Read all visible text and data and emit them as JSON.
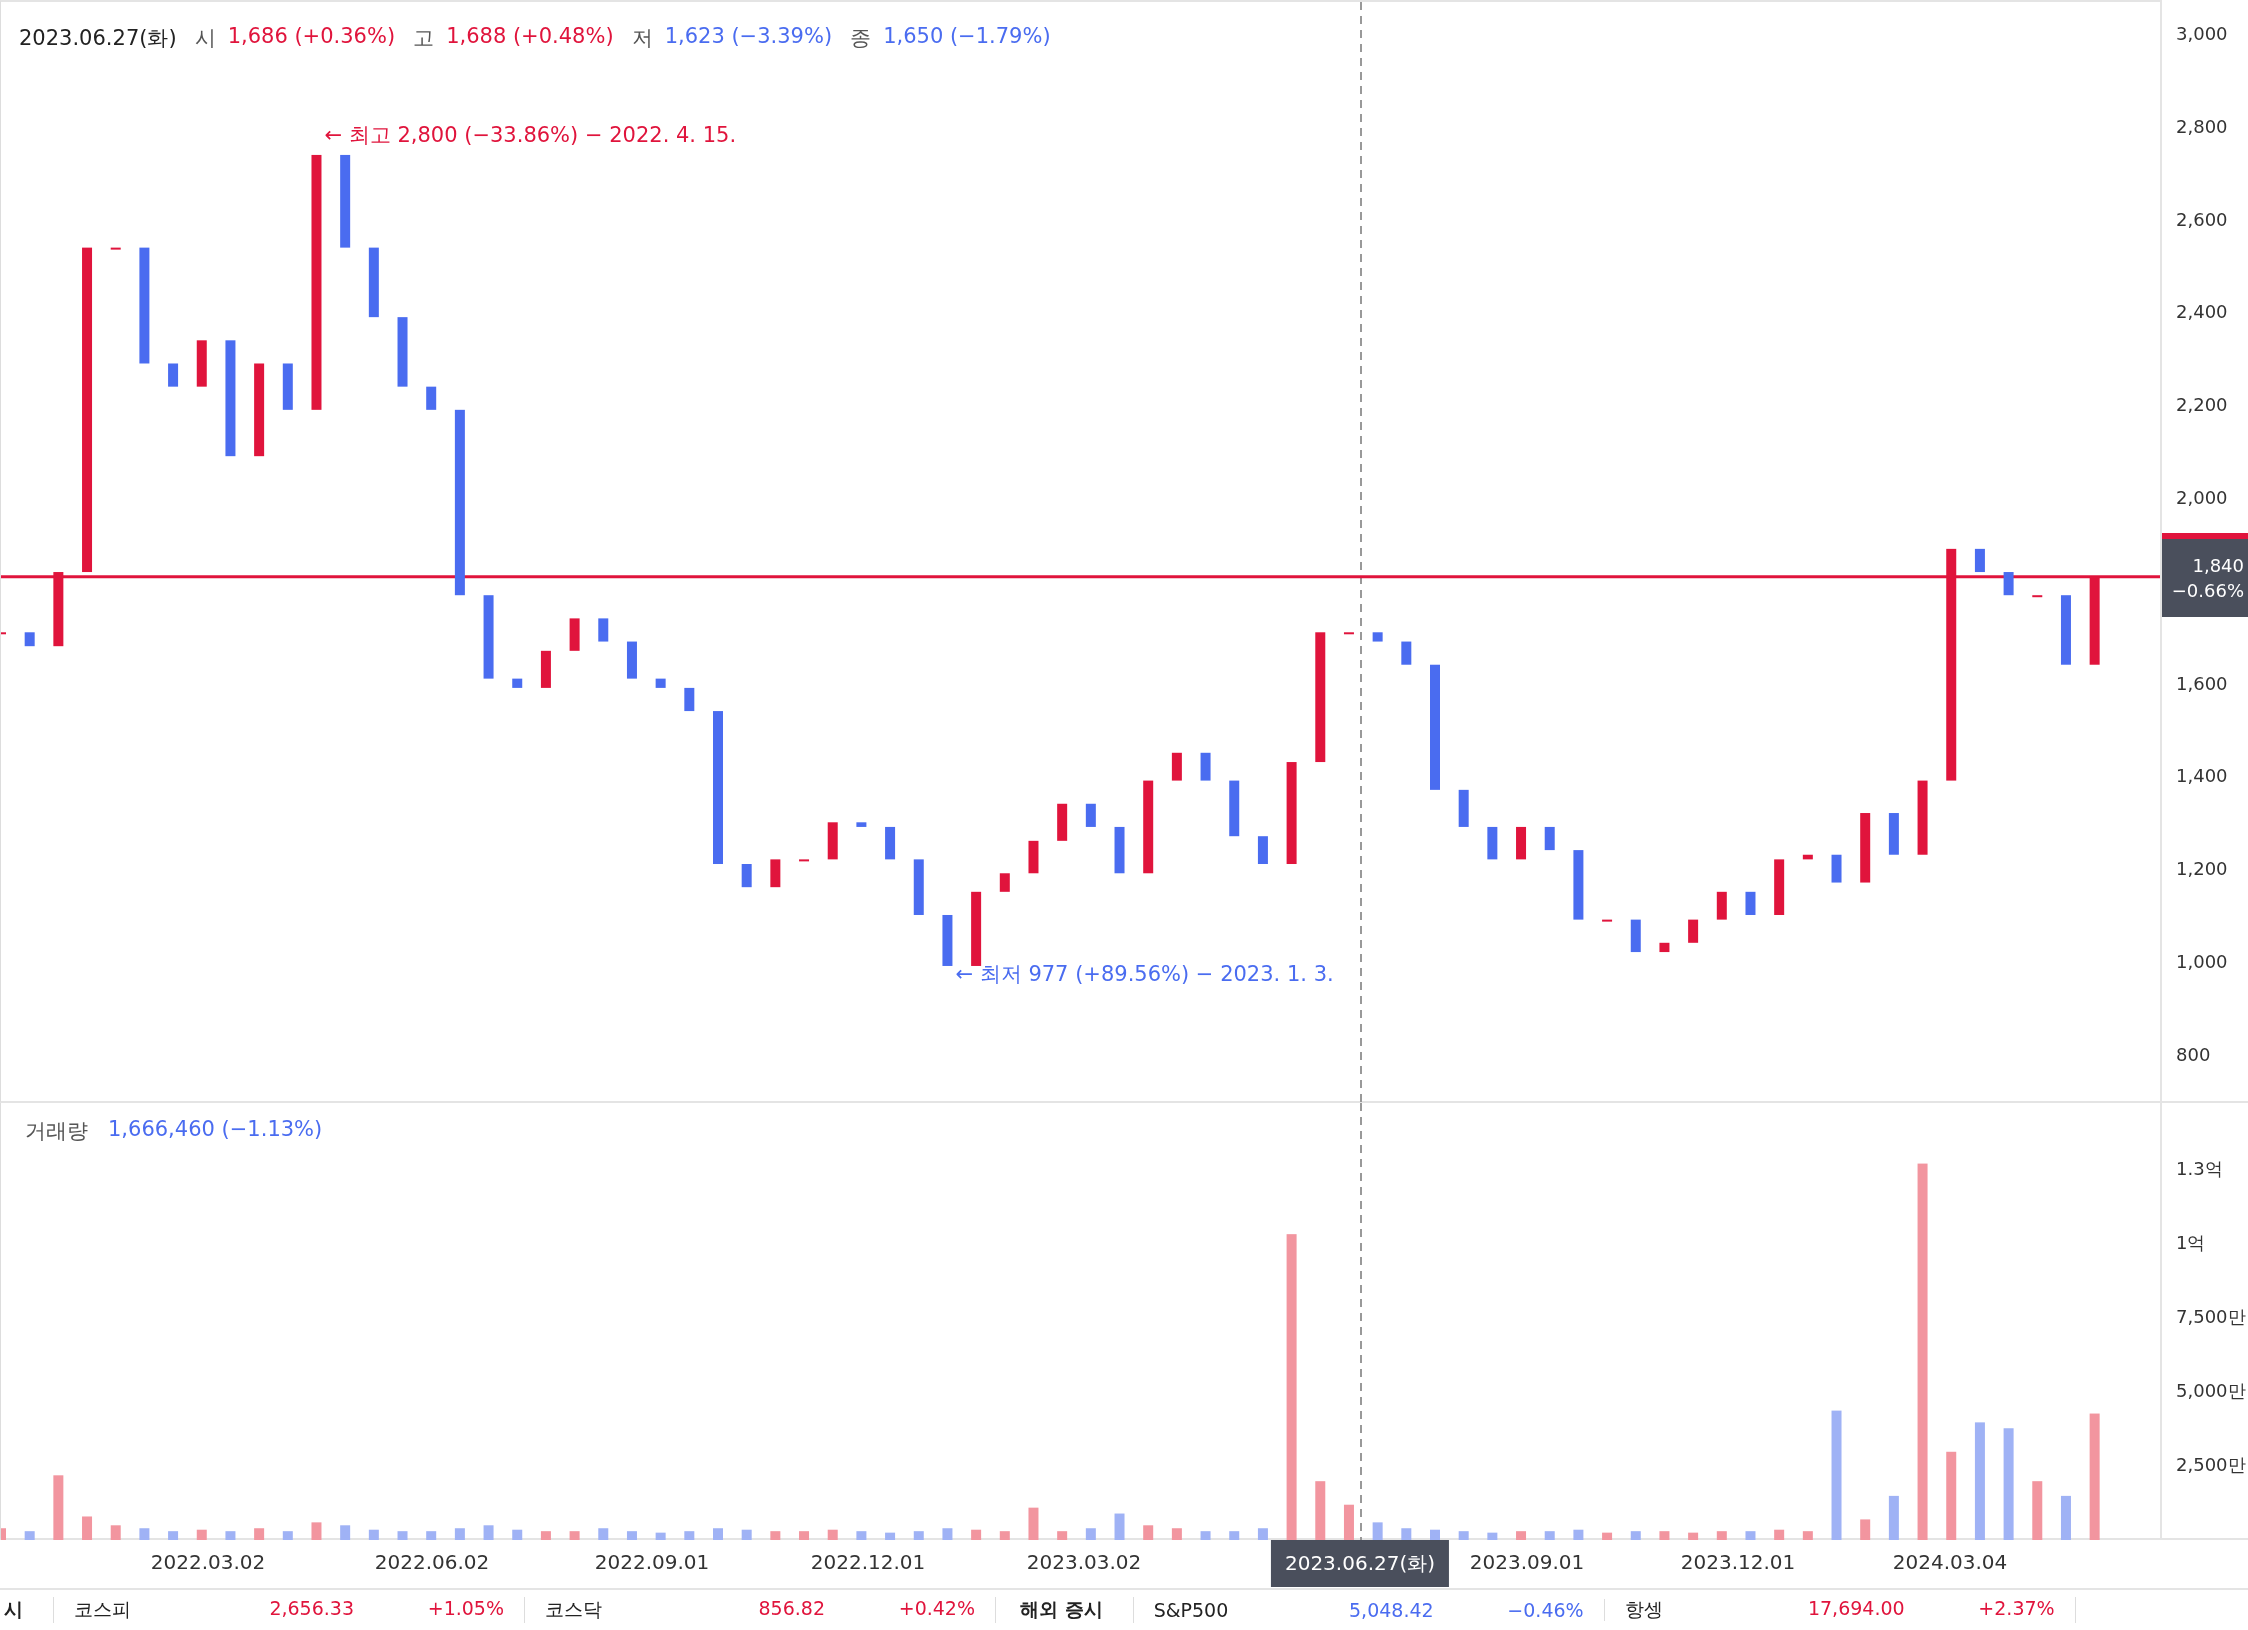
{
  "header": {
    "date": "2023.06.27(화)",
    "fields": [
      {
        "label": "시",
        "value": "1,686 (+0.36%)",
        "color": "#e0143c"
      },
      {
        "label": "고",
        "value": "1,688 (+0.48%)",
        "color": "#e0143c"
      },
      {
        "label": "저",
        "value": "1,623 (−3.39%)",
        "color": "#4a6cf0"
      },
      {
        "label": "종",
        "value": "1,650 (−1.79%)",
        "color": "#4a6cf0"
      }
    ]
  },
  "price_chart": {
    "high_label": "← 최고 2,800 (−33.86%) − 2022. 4. 15.",
    "low_label": "← 최저 977 (+89.56%) − 2023. 1. 3.",
    "axis_labels": [
      "3,000",
      "2,800",
      "2,600",
      "2,400",
      "2,200",
      "2,000",
      "1,600",
      "1,400",
      "1,200",
      "1,000",
      "800"
    ],
    "current_price": {
      "price": "1,840",
      "change": "−0.66%"
    }
  },
  "volume_chart": {
    "label": "거래량",
    "value": "1,666,460 (−1.13%)",
    "color": "#4a6cf0",
    "axis_labels": [
      "1.3억",
      "1억",
      "7,500만",
      "5,000만",
      "2,500만"
    ]
  },
  "date_axis": {
    "labels": [
      "2022.03.02",
      "2022.06.02",
      "2022.09.01",
      "2022.12.01",
      "2023.03.02",
      "2023.09.01",
      "2023.12.01",
      "2024.03.04"
    ],
    "crosshair_label": "2023.06.27(화)"
  },
  "market_bar": [
    {
      "kind": "section",
      "label": "시"
    },
    {
      "kind": "quote",
      "name": "코스피",
      "value": "2,656.33",
      "change": "+1.05%",
      "color": "#e0143c"
    },
    {
      "kind": "quote",
      "name": "코스닥",
      "value": "856.82",
      "change": "+0.42%",
      "color": "#e0143c"
    },
    {
      "kind": "section",
      "label": "해외 증시"
    },
    {
      "kind": "quote",
      "name": "S&P500",
      "value": "5,048.42",
      "change": "−0.46%",
      "color": "#4a6cf0"
    },
    {
      "kind": "quote",
      "name": "항셍",
      "value": "17,694.00",
      "change": "+2.37%",
      "color": "#e0143c"
    }
  ]
}
